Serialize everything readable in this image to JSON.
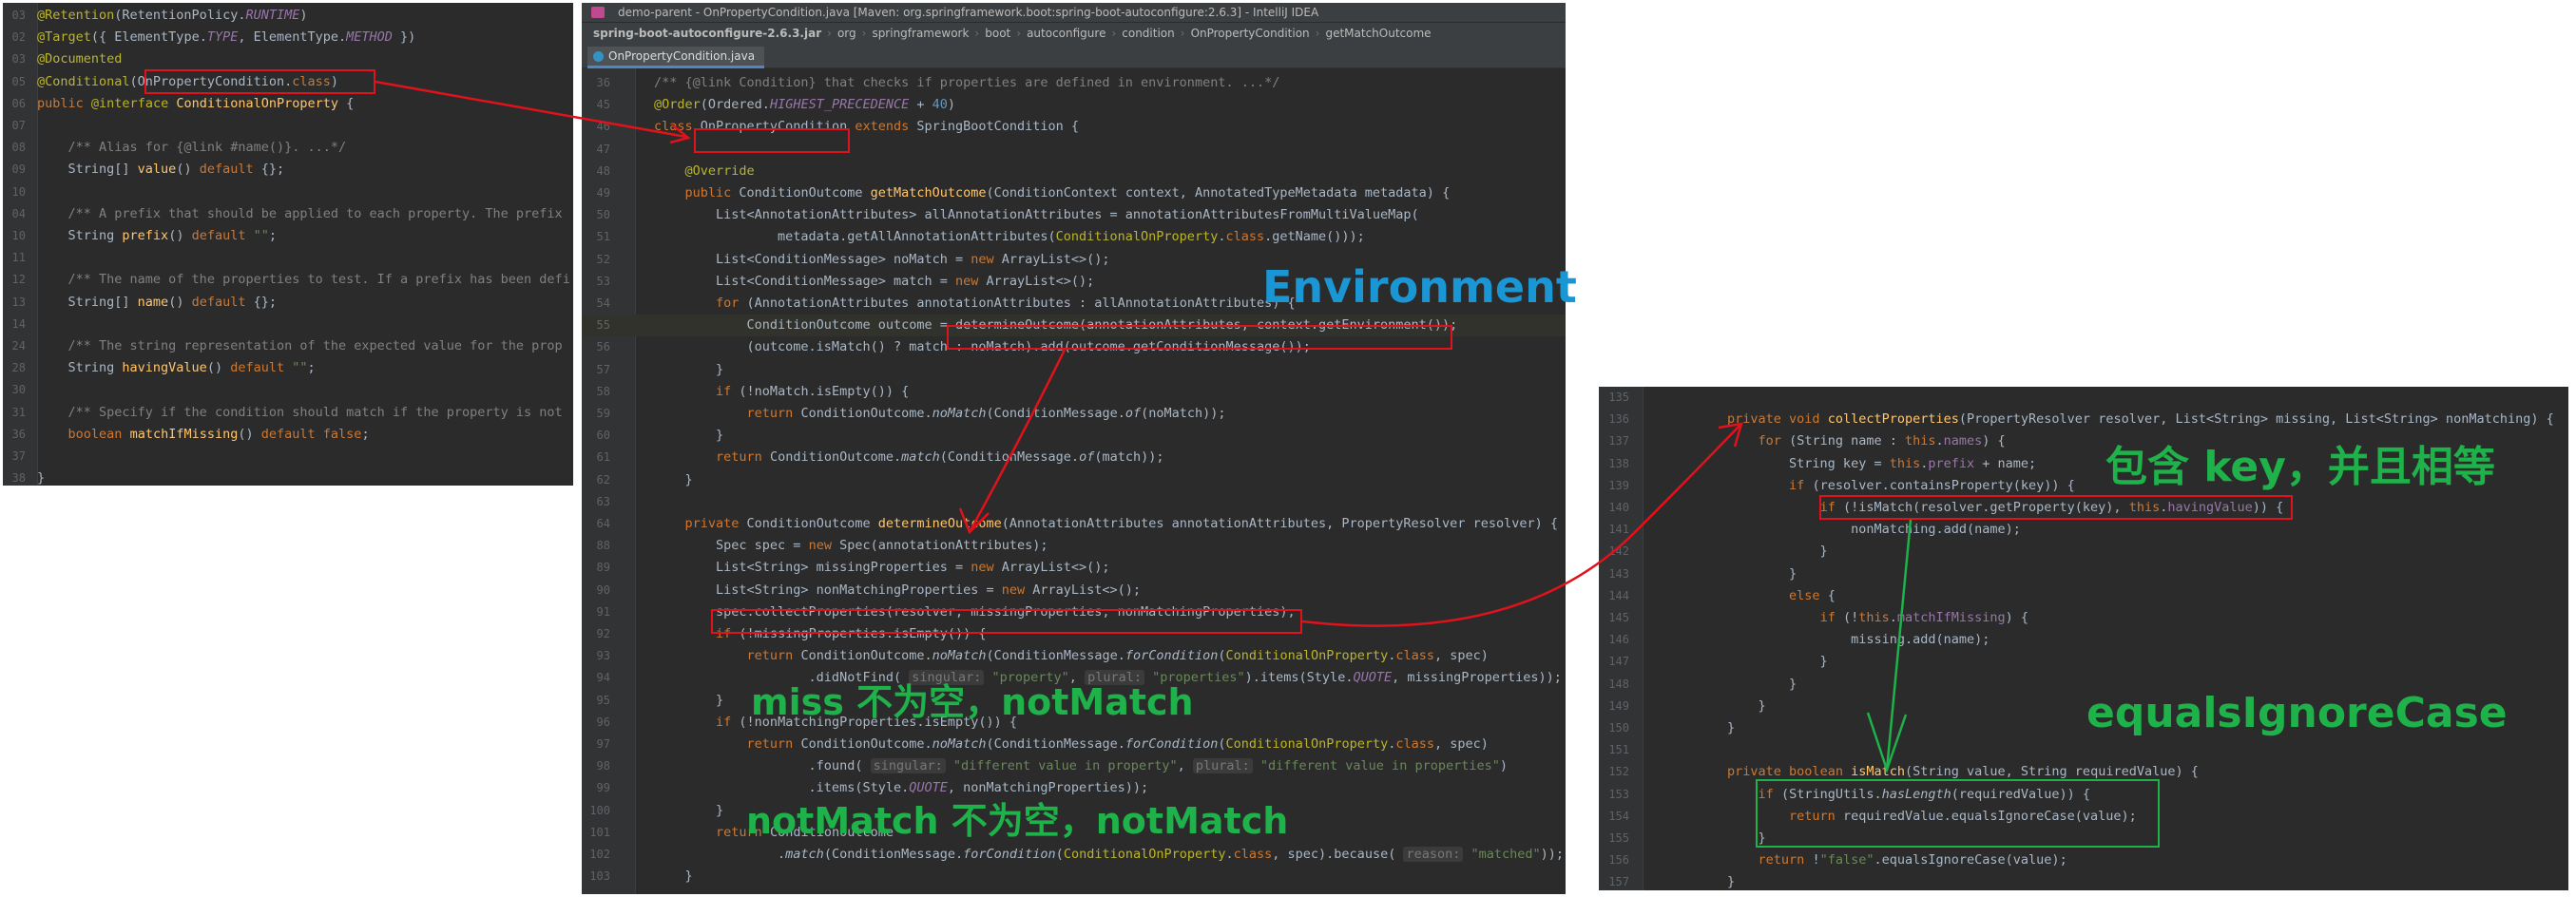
{
  "left_panel": {
    "lines": [
      {
        "n": "03",
        "html": "<span class='an'>@Retention</span>(RetentionPolicy.<span class='ct'>RUNTIME</span>)"
      },
      {
        "n": "02",
        "html": "<span class='an'>@Target</span>({ ElementType.<span class='ct'>TYPE</span>, ElementType.<span class='ct'>METHOD</span> })"
      },
      {
        "n": "03",
        "html": "<span class='an'>@Documented</span>"
      },
      {
        "n": "05",
        "html": "<span class='an'>@Conditional</span>(OnPropertyCondition.<span class='kw'>class</span>)"
      },
      {
        "n": "06",
        "html": "<span class='kw'>public</span> <span class='an'>@interface</span> <span class='fn'>ConditionalOnProperty</span> {"
      },
      {
        "n": "07",
        "html": ""
      },
      {
        "n": "08",
        "html": "    <span class='cm'>/** Alias for {@link #name()}. ...*/</span>"
      },
      {
        "n": "09",
        "html": "    String[] <span class='fn'>value</span>() <span class='kw'>default</span> {};"
      },
      {
        "n": "10",
        "html": ""
      },
      {
        "n": "04",
        "html": "    <span class='cm'>/** A prefix that should be applied to each property. The prefix</span>"
      },
      {
        "n": "10",
        "html": "    String <span class='fn'>prefix</span>() <span class='kw'>default</span> <span class='st'>\"\"</span>;"
      },
      {
        "n": "11",
        "html": ""
      },
      {
        "n": "12",
        "html": "    <span class='cm'>/** The name of the properties to test. If a prefix has been defi</span>"
      },
      {
        "n": "13",
        "html": "    String[] <span class='fn'>name</span>() <span class='kw'>default</span> {};"
      },
      {
        "n": "14",
        "html": ""
      },
      {
        "n": "24",
        "html": "    <span class='cm'>/** The string representation of the expected value for the prop</span>"
      },
      {
        "n": "28",
        "html": "    String <span class='fn'>havingValue</span>() <span class='kw'>default</span> <span class='st'>\"\"</span>;"
      },
      {
        "n": "30",
        "html": ""
      },
      {
        "n": "31",
        "html": "    <span class='cm'>/** Specify if the condition should match if the property is not</span>"
      },
      {
        "n": "36",
        "html": "    <span class='kw'>boolean</span> <span class='fn'>matchIfMissing</span>() <span class='kw'>default</span> <span class='kw'>false</span>;"
      },
      {
        "n": "37",
        "html": ""
      },
      {
        "n": "38",
        "html": "}"
      }
    ]
  },
  "middle_panel": {
    "title": "demo-parent - OnPropertyCondition.java [Maven: org.springframework.boot:spring-boot-autoconfigure:2.6.3] - IntelliJ IDEA",
    "breadcrumbs": [
      "spring-boot-autoconfigure-2.6.3.jar",
      "org",
      "springframework",
      "boot",
      "autoconfigure",
      "condition",
      "OnPropertyCondition",
      "getMatchOutcome"
    ],
    "tab": "OnPropertyCondition.java",
    "lines": [
      {
        "n": "36",
        "html": "<span class='cm'>/** {@link Condition} that checks if properties are defined in environment. ...*/</span>"
      },
      {
        "n": "45",
        "html": "<span class='an'>@Order</span>(Ordered.<span class='ct'>HIGHEST_PRECEDENCE</span> + <span class='nm'>40</span>)"
      },
      {
        "n": "46",
        "html": "<span class='kw'>class</span> OnPropertyCondition <span class='kw'>extends</span> SpringBootCondition {"
      },
      {
        "n": "47",
        "html": ""
      },
      {
        "n": "48",
        "html": "    <span class='an'>@Override</span>"
      },
      {
        "n": "49",
        "html": "    <span class='kw'>public</span> ConditionOutcome <span class='fn'>getMatchOutcome</span>(ConditionContext context, AnnotatedTypeMetadata metadata) {"
      },
      {
        "n": "50",
        "html": "        List&lt;AnnotationAttributes&gt; allAnnotationAttributes = annotationAttributesFromMultiValueMap("
      },
      {
        "n": "51",
        "html": "                metadata.getAllAnnotationAttributes(<span class='an'>ConditionalOnProperty</span>.<span class='kw'>class</span>.getName()));"
      },
      {
        "n": "52",
        "html": "        List&lt;ConditionMessage&gt; noMatch = <span class='kw'>new</span> ArrayList&lt;&gt;();"
      },
      {
        "n": "53",
        "html": "        List&lt;ConditionMessage&gt; match = <span class='kw'>new</span> ArrayList&lt;&gt;();"
      },
      {
        "n": "54",
        "html": "        <span class='kw'>for</span> (AnnotationAttributes annotationAttributes : allAnnotationAttributes) {"
      },
      {
        "n": "55",
        "html": "            ConditionOutcome outcome = determineOutcome(annotationAttributes, context.getEnvironment());",
        "hl": true
      },
      {
        "n": "56",
        "html": "            (outcome.isMatch() ? match : noMatch).add(outcome.getConditionMessage());"
      },
      {
        "n": "57",
        "html": "        }"
      },
      {
        "n": "58",
        "html": "        <span class='kw'>if</span> (!noMatch.isEmpty()) {"
      },
      {
        "n": "59",
        "html": "            <span class='kw'>return</span> ConditionOutcome.<span class='it'>noMatch</span>(ConditionMessage.<span class='it'>of</span>(noMatch));"
      },
      {
        "n": "60",
        "html": "        }"
      },
      {
        "n": "61",
        "html": "        <span class='kw'>return</span> ConditionOutcome.<span class='it'>match</span>(ConditionMessage.<span class='it'>of</span>(match));"
      },
      {
        "n": "62",
        "html": "    }"
      },
      {
        "n": "63",
        "html": ""
      },
      {
        "n": "64",
        "html": "    <span class='kw'>private</span> ConditionOutcome <span class='fn'>determineOutcome</span>(AnnotationAttributes annotationAttributes, PropertyResolver resolver) {"
      },
      {
        "n": "88",
        "html": "        Spec spec = <span class='kw'>new</span> Spec(annotationAttributes);"
      },
      {
        "n": "89",
        "html": "        List&lt;String&gt; missingProperties = <span class='kw'>new</span> ArrayList&lt;&gt;();"
      },
      {
        "n": "90",
        "html": "        List&lt;String&gt; nonMatchingProperties = <span class='kw'>new</span> ArrayList&lt;&gt;();"
      },
      {
        "n": "91",
        "html": "        spec.collectProperties(resolver, missingProperties, nonMatchingProperties);"
      },
      {
        "n": "92",
        "html": "        <span class='kw'>if</span> (!missingProperties.isEmpty()) {"
      },
      {
        "n": "93",
        "html": "            <span class='kw'>return</span> ConditionOutcome.<span class='it'>noMatch</span>(ConditionMessage.<span class='it'>forCondition</span>(<span class='an'>ConditionalOnProperty</span>.<span class='kw'>class</span>, spec)"
      },
      {
        "n": "94",
        "html": "                    .didNotFind( <span class='hint'>singular:</span> <span class='st'>\"property\"</span>, <span class='hint'>plural:</span> <span class='st'>\"properties\"</span>).items(Style.<span class='ct'>QUOTE</span>, missingProperties));"
      },
      {
        "n": "95",
        "html": "        }"
      },
      {
        "n": "96",
        "html": "        <span class='kw'>if</span> (!nonMatchingProperties.isEmpty()) {"
      },
      {
        "n": "97",
        "html": "            <span class='kw'>return</span> ConditionOutcome.<span class='it'>noMatch</span>(ConditionMessage.<span class='it'>forCondition</span>(<span class='an'>ConditionalOnProperty</span>.<span class='kw'>class</span>, spec)"
      },
      {
        "n": "98",
        "html": "                    .found( <span class='hint'>singular:</span> <span class='st'>\"different value in property\"</span>, <span class='hint'>plural:</span> <span class='st'>\"different value in properties\"</span>)"
      },
      {
        "n": "99",
        "html": "                    .items(Style.<span class='ct'>QUOTE</span>, nonMatchingProperties));"
      },
      {
        "n": "100",
        "html": "        }"
      },
      {
        "n": "101",
        "html": "        <span class='kw'>return</span> ConditionOutcome"
      },
      {
        "n": "102",
        "html": "                .<span class='it'>match</span>(ConditionMessage.<span class='it'>forCondition</span>(<span class='an'>ConditionalOnProperty</span>.<span class='kw'>class</span>, spec).because( <span class='hint'>reason:</span> <span class='st'>\"matched\"</span>));"
      },
      {
        "n": "103",
        "html": "    }"
      }
    ]
  },
  "right_panel": {
    "lines": [
      {
        "n": "135",
        "html": ""
      },
      {
        "n": "136",
        "html": "        <span class='kw'>private void</span> <span class='fn'>collectProperties</span>(PropertyResolver resolver, List&lt;String&gt; missing, List&lt;String&gt; nonMatching) {"
      },
      {
        "n": "137",
        "html": "            <span class='kw'>for</span> (String name : <span class='kw'>this</span>.<span class='fd'>names</span>) {"
      },
      {
        "n": "138",
        "html": "                String key = <span class='kw'>this</span>.<span class='fd'>prefix</span> + name;"
      },
      {
        "n": "139",
        "html": "                <span class='kw'>if</span> (resolver.containsProperty(key)) {"
      },
      {
        "n": "140",
        "html": "                    <span class='kw'>if</span> (!isMatch(resolver.getProperty(key), <span class='kw'>this</span>.<span class='fd'>havingValue</span>)) {"
      },
      {
        "n": "141",
        "html": "                        nonMatching.add(name);"
      },
      {
        "n": "142",
        "html": "                    }"
      },
      {
        "n": "143",
        "html": "                }"
      },
      {
        "n": "144",
        "html": "                <span class='kw'>else</span> {"
      },
      {
        "n": "145",
        "html": "                    <span class='kw'>if</span> (!<span class='kw'>this</span>.<span class='fd'>matchIfMissing</span>) {"
      },
      {
        "n": "146",
        "html": "                        missing.add(name);"
      },
      {
        "n": "147",
        "html": "                    }"
      },
      {
        "n": "148",
        "html": "                }"
      },
      {
        "n": "149",
        "html": "            }"
      },
      {
        "n": "150",
        "html": "        }"
      },
      {
        "n": "151",
        "html": ""
      },
      {
        "n": "152",
        "html": "        <span class='kw'>private boolean</span> <span class='fn'>isMatch</span>(String value, String requiredValue) {"
      },
      {
        "n": "153",
        "html": "            <span class='kw'>if</span> (StringUtils.<span class='it'>hasLength</span>(requiredValue)) {"
      },
      {
        "n": "154",
        "html": "                <span class='kw'>return</span> requiredValue.equalsIgnoreCase(value);"
      },
      {
        "n": "155",
        "html": "            }"
      },
      {
        "n": "156",
        "html": "            <span class='kw'>return</span> !<span class='st'>\"false\"</span>.equalsIgnoreCase(value);"
      },
      {
        "n": "157",
        "html": "        }"
      }
    ]
  },
  "annotations": {
    "environment": "Environment",
    "contains_key": "包含 key，并且相等",
    "equals_ignore_case": "equalsIgnoreCase",
    "miss_not_empty": "miss 不为空，notMatch",
    "not_match_not_empty": "notMatch 不为空，notMatch"
  },
  "colors": {
    "editor_bg": "#2b2b2b",
    "red_box": "#e0121b",
    "green_box": "#1fb24a",
    "blue_text": "#1a96d4",
    "green_text": "#1fb24a"
  }
}
